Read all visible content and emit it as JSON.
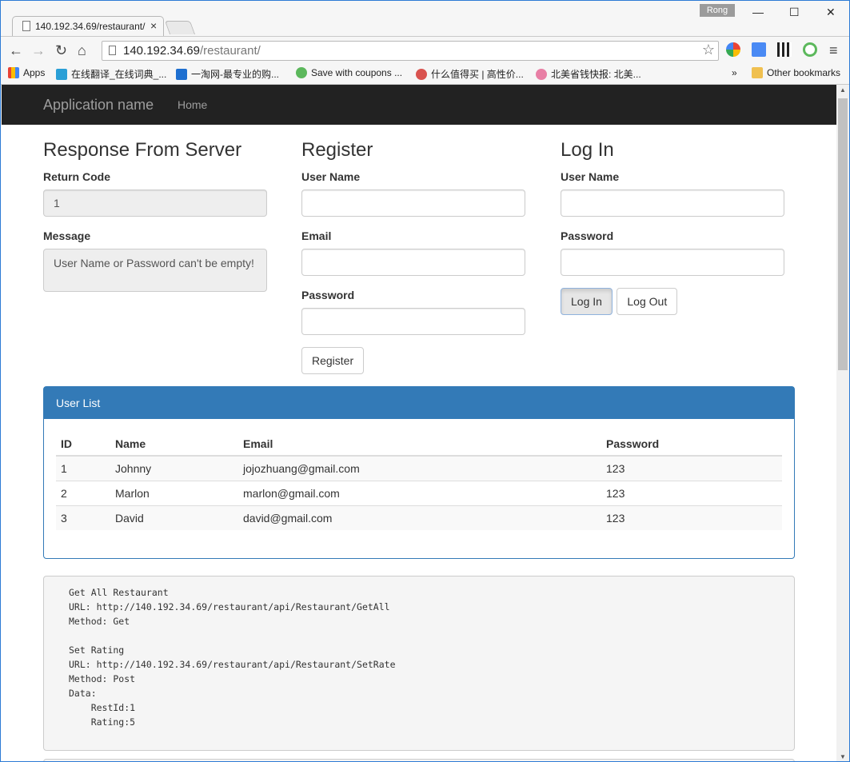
{
  "browser": {
    "tab_title": "140.192.34.69/restaurant/",
    "tab_close": "×",
    "profile_name": "Rong",
    "url_host": "140.192.34.69",
    "url_path": "/restaurant/",
    "bookmarks": [
      {
        "label": "Apps",
        "color": "#4285f4"
      },
      {
        "label": "在线翻译_在线词典_...",
        "color": "#2a9fd6"
      },
      {
        "label": "一淘网-最专业的购...",
        "color": "#1e6fd0"
      },
      {
        "label": "Save with coupons ...",
        "color": "#5cb85c"
      },
      {
        "label": "什么值得买 | 高性价...",
        "color": "#d9534f"
      },
      {
        "label": "北美省钱快报: 北美...",
        "color": "#e87fa5"
      }
    ],
    "bookmarks_overflow": "»",
    "other_bookmarks": "Other bookmarks"
  },
  "nav": {
    "brand": "Application name",
    "home": "Home"
  },
  "response": {
    "heading": "Response From Server",
    "return_code_label": "Return Code",
    "return_code_value": "1",
    "message_label": "Message",
    "message_value": "User Name or Password can't be empty!"
  },
  "register": {
    "heading": "Register",
    "username_label": "User Name",
    "email_label": "Email",
    "password_label": "Password",
    "button": "Register"
  },
  "login": {
    "heading": "Log In",
    "username_label": "User Name",
    "password_label": "Password",
    "login_button": "Log In",
    "logout_button": "Log Out"
  },
  "user_list": {
    "title": "User List",
    "columns": [
      "ID",
      "Name",
      "Email",
      "Password"
    ],
    "rows": [
      [
        "1",
        "Johnny",
        "jojozhuang@gmail.com",
        "123"
      ],
      [
        "2",
        "Marlon",
        "marlon@gmail.com",
        "123"
      ],
      [
        "3",
        "David",
        "david@gmail.com",
        "123"
      ]
    ]
  },
  "api_docs": "Get All Restaurant\nURL: http://140.192.34.69/restaurant/api/Restaurant/GetAll\nMethod: Get\n\nSet Rating\nURL: http://140.192.34.69/restaurant/api/Restaurant/SetRate\nMethod: Post\nData:\n    RestId:1\n    Rating:5",
  "colors": {
    "navbar": "#222222",
    "panel_primary": "#337ab7",
    "window_border": "#2d7bd5"
  }
}
